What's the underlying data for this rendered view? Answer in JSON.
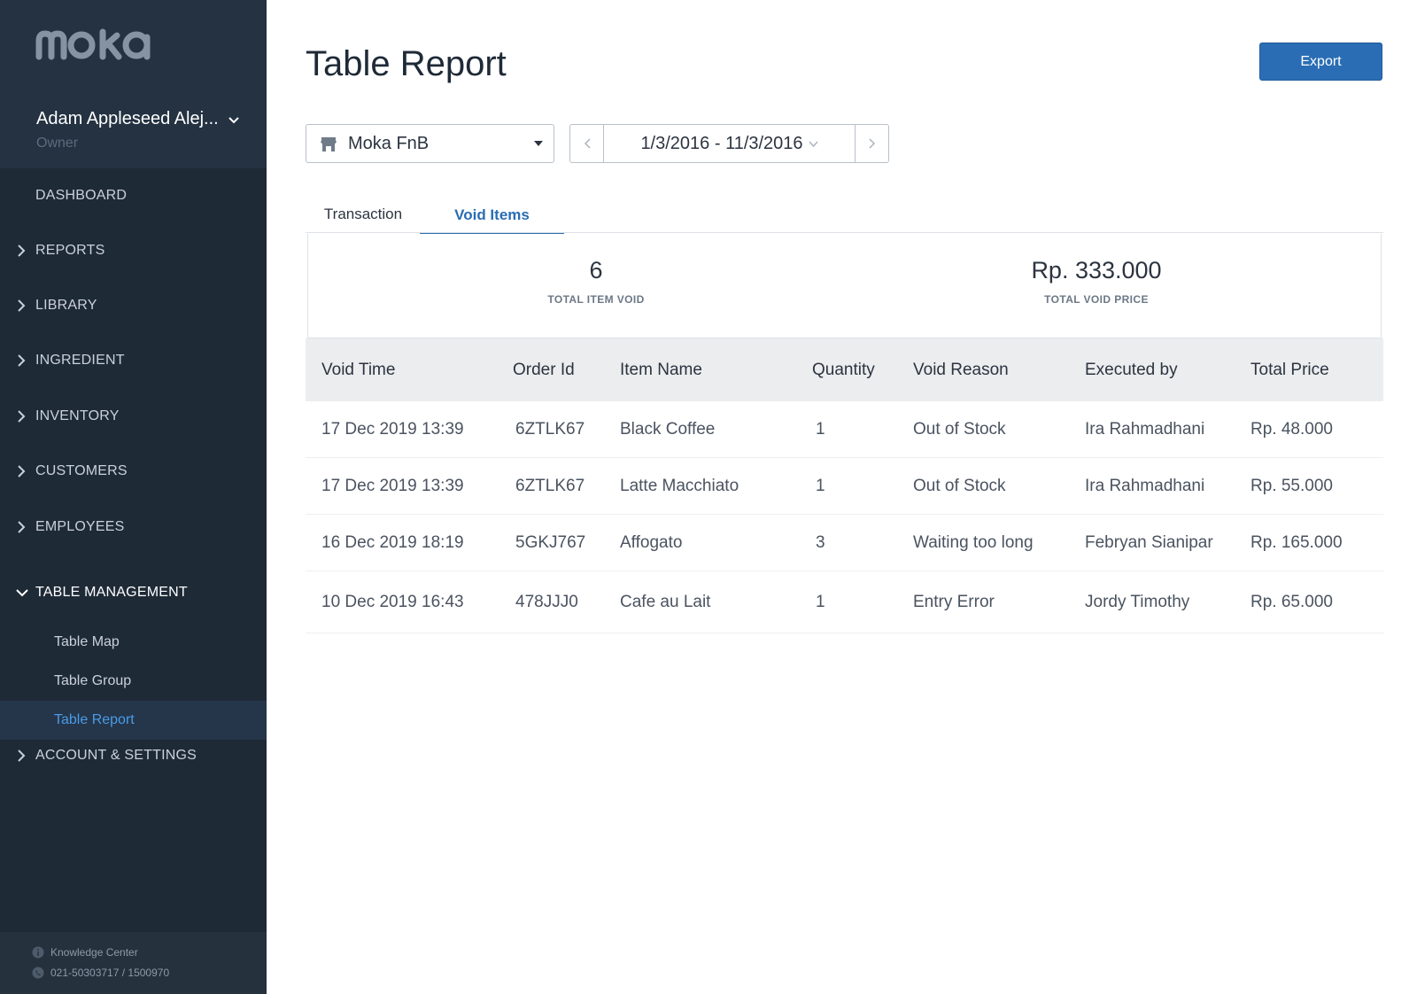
{
  "sidebar": {
    "logo_text": "moka",
    "user": {
      "name": "Adam Appleseed Alej...",
      "role": "Owner"
    },
    "nav": [
      {
        "label": "DASHBOARD"
      },
      {
        "label": "REPORTS"
      },
      {
        "label": "LIBRARY"
      },
      {
        "label": "INGREDIENT"
      },
      {
        "label": "INVENTORY"
      },
      {
        "label": "CUSTOMERS"
      },
      {
        "label": "EMPLOYEES"
      },
      {
        "label": "TABLE MANAGEMENT"
      },
      {
        "label": "ACCOUNT & SETTINGS"
      }
    ],
    "sub_items": [
      {
        "label": "Table Map"
      },
      {
        "label": "Table Group"
      },
      {
        "label": "Table Report"
      }
    ],
    "footer": {
      "knowledge": "Knowledge Center",
      "phone": "021-50303717 / 1500970"
    }
  },
  "header": {
    "title": "Table Report",
    "export_label": "Export"
  },
  "filters": {
    "outlet": "Moka FnB",
    "date_range": "1/3/2016 - 11/3/2016"
  },
  "tabs": [
    {
      "label": "Transaction"
    },
    {
      "label": "Void Items"
    }
  ],
  "summary": {
    "total_item_void": "6",
    "total_item_void_label": "TOTAL ITEM VOID",
    "total_void_price": "Rp. 333.000",
    "total_void_price_label": "TOTAL VOID PRICE"
  },
  "table": {
    "headers": [
      "Void Time",
      "Order Id",
      "Item Name",
      "Quantity",
      "Void Reason",
      "Executed by",
      "Total Price"
    ],
    "rows": [
      [
        "17 Dec 2019 13:39",
        "6ZTLK67",
        "Black Coffee",
        "1",
        "Out of Stock",
        "Ira Rahmadhani",
        "Rp. 48.000"
      ],
      [
        "17 Dec 2019 13:39",
        "6ZTLK67",
        "Latte Macchiato",
        "1",
        "Out of Stock",
        "Ira Rahmadhani",
        "Rp. 55.000"
      ],
      [
        "16 Dec 2019 18:19",
        "5GKJ767",
        "Affogato",
        "3",
        "Waiting too long",
        "Febryan Sianipar",
        "Rp. 165.000"
      ],
      [
        "10 Dec 2019 16:43",
        "478JJJ0",
        "Cafe au Lait",
        "1",
        "Entry Error",
        "Jordy Timothy",
        "Rp. 65.000"
      ]
    ]
  },
  "colors": {
    "sidebar_bg": "#1f2a37",
    "accent": "#2a6db4",
    "active_sub": "#4a9be8"
  }
}
